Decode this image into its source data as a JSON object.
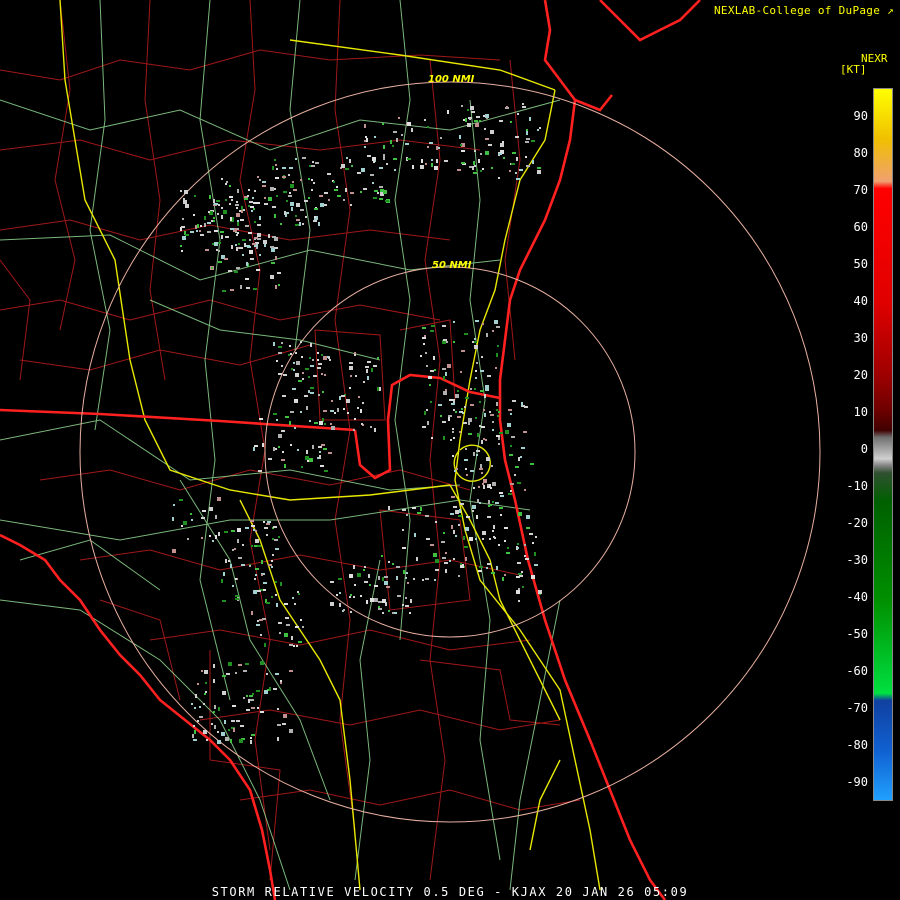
{
  "header": {
    "credit": "NEXLAB-College of DuPage ↗"
  },
  "legend": {
    "title": "NEXR",
    "unit": "[KT]",
    "ticks": [
      "90",
      "80",
      "70",
      "60",
      "50",
      "40",
      "30",
      "20",
      "10",
      "0",
      "-10",
      "-20",
      "-30",
      "-40",
      "-50",
      "-60",
      "-70",
      "-80",
      "-90"
    ]
  },
  "rings": [
    {
      "label": "50 NMI",
      "nmi": 50
    },
    {
      "label": "100 NMI",
      "nmi": 100
    }
  ],
  "footer": {
    "product": "STORM RELATIVE VELOCITY 0.5 DEG - KJAX 20 JAN 26 05:09"
  },
  "colors": {
    "background": "#000000",
    "state_border": "#ff2020",
    "county_border": "#a01818",
    "highway": "#e8e800",
    "road": "#90d890",
    "ring": "#e8b0a0",
    "text": "#ffff00"
  }
}
